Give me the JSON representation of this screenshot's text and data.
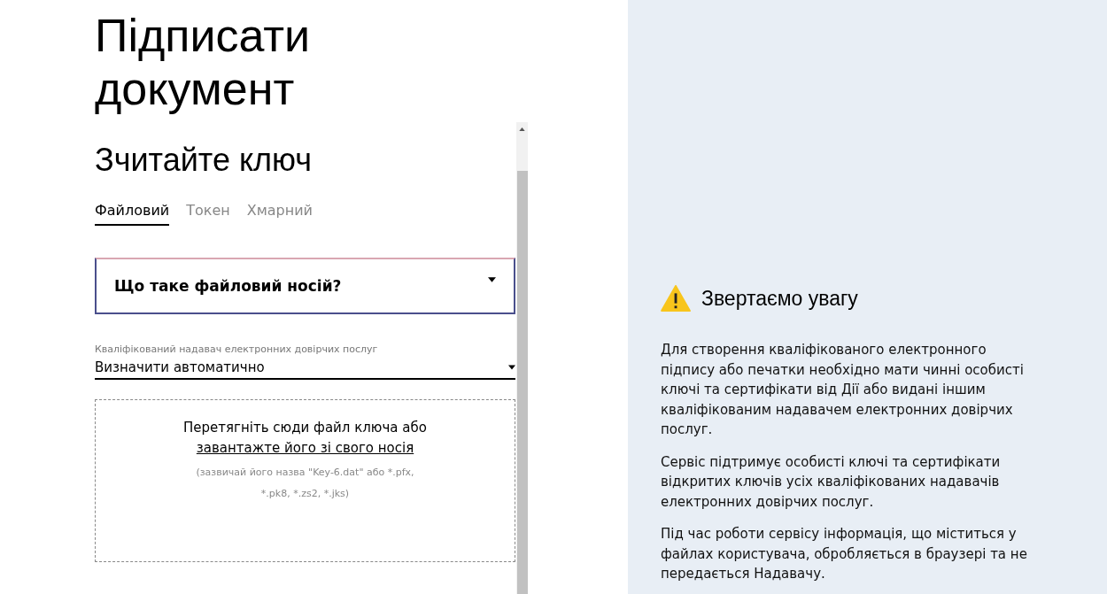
{
  "page_title": "Підписати документ",
  "section_title": "Зчитайте ключ",
  "tabs": [
    {
      "label": "Файловий",
      "selected": true
    },
    {
      "label": "Токен",
      "selected": false
    },
    {
      "label": "Хмарний",
      "selected": false
    }
  ],
  "faq": {
    "question": "Що таке файловий носій?",
    "expanded": false
  },
  "provider": {
    "label": "Кваліфікований надавач електронних довірчих послуг",
    "value": "Визначити автоматично"
  },
  "dropzone": {
    "text": "Перетягніть сюди файл ключа",
    "prefix": "або",
    "link": "завантажте його зі свого носія",
    "hint": "(зазвичай його назва \"Key-6.dat\" або *.pfx, *.pk8, *.zs2, *.jks)"
  },
  "notice": {
    "title": "Звертаємо увагу",
    "paragraphs": [
      "Для створення кваліфікованого електронного підпису або печатки необхідно мати чинні особисті ключі та сертифікати від Дії або видані іншим кваліфікованим надавачем електронних довірчих послуг.",
      "Сервіс підтримує особисті ключі та сертифікати відкритих ключів усіх кваліфікованих надавачів електронних довірчих послуг.",
      "Під час роботи сервісу інформація, що міститься у файлах користувача, обробляється в браузері та не передається Надавачу."
    ]
  }
}
